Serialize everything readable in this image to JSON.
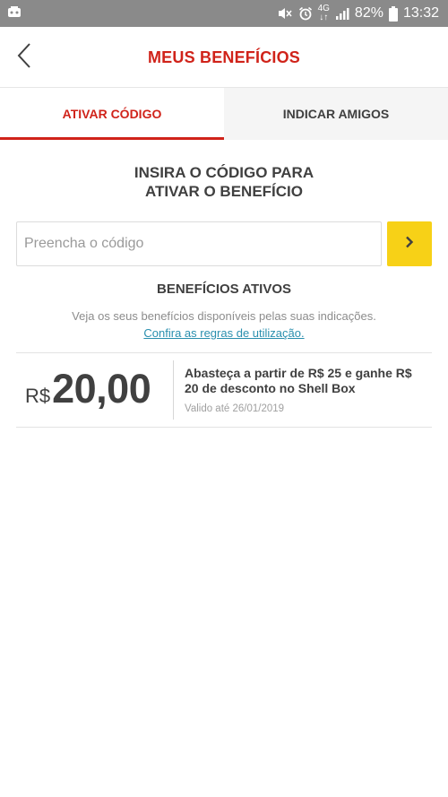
{
  "status_bar": {
    "network_top": "4G",
    "network_bottom": "↓↑",
    "battery": "82%",
    "time": "13:32"
  },
  "header": {
    "title": "MEUS BENEFÍCIOS"
  },
  "tabs": [
    {
      "label": "ATIVAR CÓDIGO",
      "active": true
    },
    {
      "label": "INDICAR AMIGOS",
      "active": false
    }
  ],
  "code_section": {
    "heading_line1": "INSIRA O CÓDIGO PARA",
    "heading_line2": "ATIVAR O BENEFÍCIO",
    "input_placeholder": "Preencha o código",
    "input_value": ""
  },
  "benefits_section": {
    "heading": "BENEFÍCIOS ATIVOS",
    "description": "Veja os seus benefícios disponíveis pelas suas indicações.",
    "rules_link": "Confira as regras de utilização."
  },
  "benefits": [
    {
      "currency": "R$",
      "value": "20,00",
      "title": "Abasteça a partir de R$ 25 e ganhe R$ 20 de desconto no Shell Box",
      "validity": "Valido até 26/01/2019"
    }
  ],
  "colors": {
    "brand_red": "#d0231a",
    "brand_yellow": "#f7d117",
    "link_blue": "#2a8fae",
    "status_bar": "#8a8a8a"
  }
}
